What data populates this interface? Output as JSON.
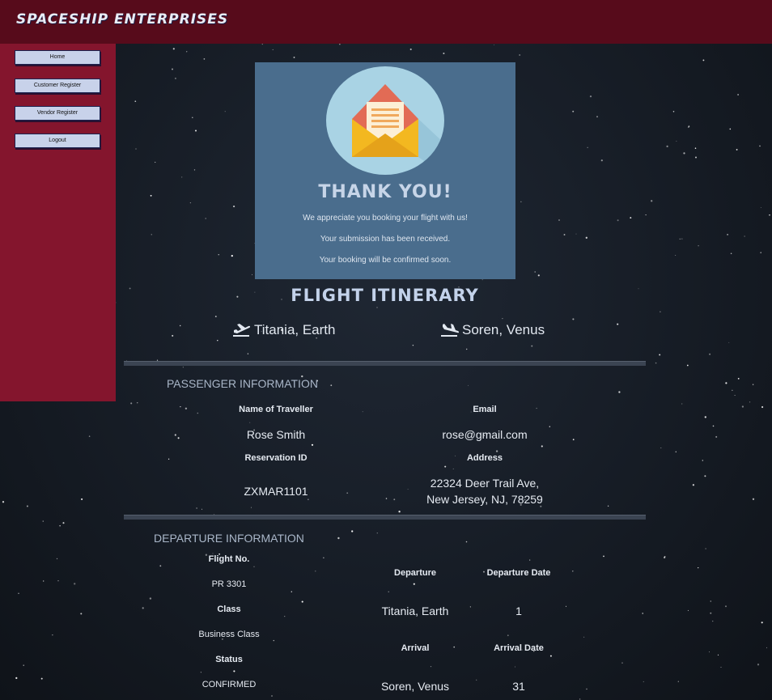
{
  "brand": "Spaceship Enterprises",
  "nav": {
    "home": "Home",
    "customer_register": "Customer Register",
    "vendor_register": "Vendor Register",
    "logout": "Logout"
  },
  "thank_you": {
    "title": "Thank You!",
    "line1": "We appreciate you booking your flight with us!",
    "line2": "Your submission has been received.",
    "line3": "Your booking will be confirmed soon.",
    "icon": "envelope-letter-icon"
  },
  "itinerary": {
    "title": "Flight Itinerary",
    "from": "Titania, Earth",
    "to": "Soren, Venus",
    "from_icon": "plane-takeoff-icon",
    "to_icon": "plane-landing-icon"
  },
  "passenger": {
    "section_title": "PASSENGER INFORMATION",
    "name_label": "Name of Traveller",
    "name": "Rose Smith",
    "email_label": "Email",
    "email": "rose@gmail.com",
    "reservation_label": "Reservation ID",
    "reservation_id": "ZXMAR1101",
    "address_label": "Address",
    "address_line1": "22324 Deer Trail Ave,",
    "address_line2": "New Jersey, NJ, 78259"
  },
  "departure": {
    "section_title": "DEPARTURE INFORMATION",
    "flight_no_label": "Flight No.",
    "flight_no": "PR 3301",
    "class_label": "Class",
    "class": "Business Class",
    "status_label": "Status",
    "status": "CONFIRMED",
    "departure_label": "Departure",
    "departure": "Titania, Earth",
    "departure_date_label": "Departure Date",
    "departure_date": "1",
    "arrival_label": "Arrival",
    "arrival": "Soren, Venus",
    "arrival_date_label": "Arrival Date",
    "arrival_date": "31"
  },
  "colors": {
    "topbar": "#570b1b",
    "sidebar": "#84152d",
    "card": "#4a6d8d",
    "title": "#c3d2ea"
  }
}
